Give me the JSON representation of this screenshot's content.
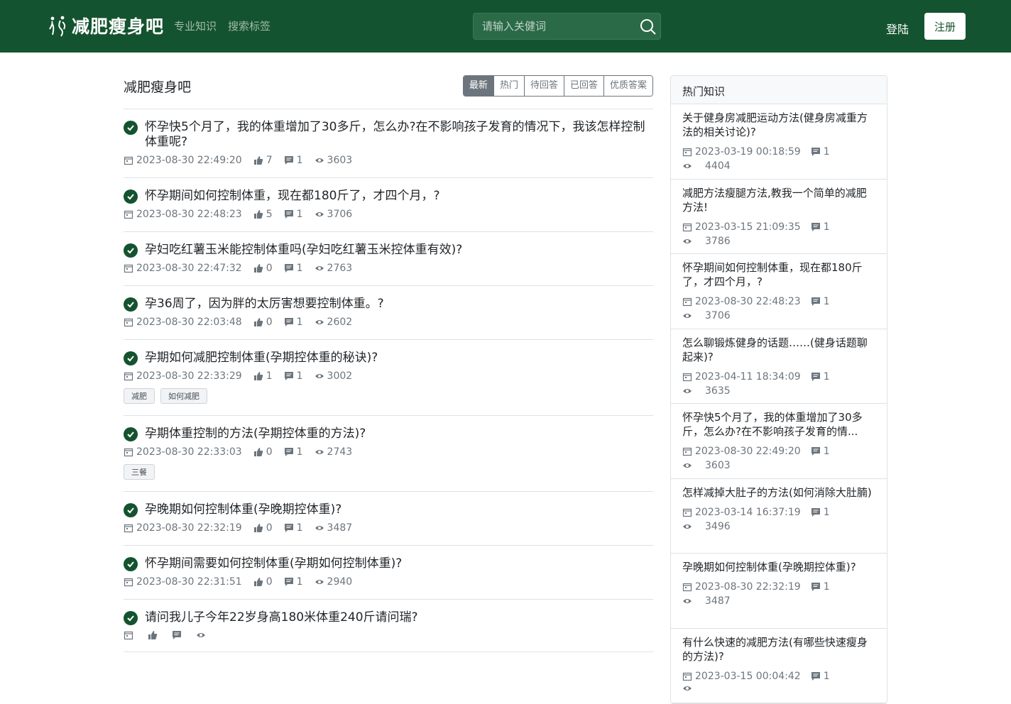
{
  "navbar": {
    "logo_text": "减肥瘦身吧",
    "links": [
      "专业知识",
      "搜索标签"
    ],
    "search_placeholder": "请输入关健词",
    "login_label": "登陆",
    "register_label": "注册"
  },
  "main": {
    "title": "减肥瘦身吧",
    "tabs": [
      "最新",
      "热门",
      "待回答",
      "已回答",
      "优质答案"
    ],
    "questions": [
      {
        "title": "怀孕快5个月了，我的体重增加了30多斤，怎么办?在不影响孩子发育的情况下，我该怎样控制体重呢?",
        "date": "2023-08-30 22:49:20",
        "likes": "7",
        "comments": "1",
        "views": "3603",
        "tags": []
      },
      {
        "title": "怀孕期间如何控制体重，现在都180斤了，才四个月，?",
        "date": "2023-08-30 22:48:23",
        "likes": "5",
        "comments": "1",
        "views": "3706",
        "tags": []
      },
      {
        "title": "孕妇吃红薯玉米能控制体重吗(孕妇吃红薯玉米控体重有效)?",
        "date": "2023-08-30 22:47:32",
        "likes": "0",
        "comments": "1",
        "views": "2763",
        "tags": []
      },
      {
        "title": "孕36周了，因为胖的太厉害想要控制体重。?",
        "date": "2023-08-30 22:03:48",
        "likes": "0",
        "comments": "1",
        "views": "2602",
        "tags": []
      },
      {
        "title": "孕期如何减肥控制体重(孕期控体重的秘诀)?",
        "date": "2023-08-30 22:33:29",
        "likes": "1",
        "comments": "1",
        "views": "3002",
        "tags": [
          "减肥",
          "如何减肥"
        ]
      },
      {
        "title": "孕期体重控制的方法(孕期控体重的方法)?",
        "date": "2023-08-30 22:33:03",
        "likes": "0",
        "comments": "1",
        "views": "2743",
        "tags": [
          "三餐"
        ]
      },
      {
        "title": "孕晚期如何控制体重(孕晚期控体重)?",
        "date": "2023-08-30 22:32:19",
        "likes": "0",
        "comments": "1",
        "views": "3487",
        "tags": []
      },
      {
        "title": "怀孕期间需要如何控制体重(孕期如何控制体重)?",
        "date": "2023-08-30 22:31:51",
        "likes": "0",
        "comments": "1",
        "views": "2940",
        "tags": []
      },
      {
        "title": "请问我儿子今年22岁身高180米体重240斤请问瑞?",
        "date": "",
        "likes": "",
        "comments": "",
        "views": "",
        "tags": []
      }
    ]
  },
  "sidebar": {
    "title": "热门知识",
    "items": [
      {
        "title": "关于健身房减肥运动方法(健身房减重方法的相关讨论)?",
        "date": "2023-03-19 00:18:59",
        "comments": "1",
        "views": "4404"
      },
      {
        "title": "减肥方法瘦腿方法,教我一个简单的减肥方法!",
        "date": "2023-03-15 21:09:35",
        "comments": "1",
        "views": "3786"
      },
      {
        "title": "怀孕期间如何控制体重，现在都180斤了，才四个月，?",
        "date": "2023-08-30 22:48:23",
        "comments": "1",
        "views": "3706"
      },
      {
        "title": "怎么聊锻炼健身的话题……(健身话题聊起来)?",
        "date": "2023-04-11 18:34:09",
        "comments": "1",
        "views": "3635"
      },
      {
        "title": "怀孕快5个月了，我的体重增加了30多斤，怎么办?在不影响孩子发育的情...",
        "date": "2023-08-30 22:49:20",
        "comments": "1",
        "views": "3603"
      },
      {
        "title": "怎样减掉大肚子的方法(如何消除大肚腩)",
        "date": "2023-03-14 16:37:19",
        "comments": "1",
        "views": "3496"
      },
      {
        "title": "孕晚期如何控制体重(孕晚期控体重)?",
        "date": "2023-08-30 22:32:19",
        "comments": "1",
        "views": "3487"
      },
      {
        "title": "有什么快速的减肥方法(有哪些快速瘦身的方法)?",
        "date": "2023-03-15 00:04:42",
        "comments": "1",
        "views": ""
      }
    ]
  },
  "colors": {
    "brand": "#14532f",
    "muted": "#6c757d"
  },
  "icons": [
    "logo-figure-icon",
    "search-icon",
    "check-circle-icon",
    "calendar-icon",
    "thumbs-up-icon",
    "comment-icon",
    "eye-icon"
  ]
}
